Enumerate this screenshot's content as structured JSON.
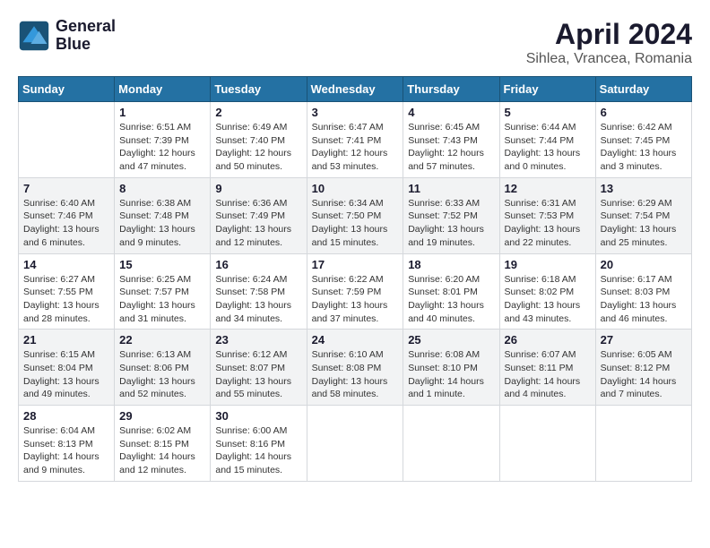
{
  "header": {
    "logo_line1": "General",
    "logo_line2": "Blue",
    "title": "April 2024",
    "subtitle": "Sihlea, Vrancea, Romania"
  },
  "calendar": {
    "days_of_week": [
      "Sunday",
      "Monday",
      "Tuesday",
      "Wednesday",
      "Thursday",
      "Friday",
      "Saturday"
    ],
    "weeks": [
      [
        {
          "day": "",
          "info": ""
        },
        {
          "day": "1",
          "info": "Sunrise: 6:51 AM\nSunset: 7:39 PM\nDaylight: 12 hours\nand 47 minutes."
        },
        {
          "day": "2",
          "info": "Sunrise: 6:49 AM\nSunset: 7:40 PM\nDaylight: 12 hours\nand 50 minutes."
        },
        {
          "day": "3",
          "info": "Sunrise: 6:47 AM\nSunset: 7:41 PM\nDaylight: 12 hours\nand 53 minutes."
        },
        {
          "day": "4",
          "info": "Sunrise: 6:45 AM\nSunset: 7:43 PM\nDaylight: 12 hours\nand 57 minutes."
        },
        {
          "day": "5",
          "info": "Sunrise: 6:44 AM\nSunset: 7:44 PM\nDaylight: 13 hours\nand 0 minutes."
        },
        {
          "day": "6",
          "info": "Sunrise: 6:42 AM\nSunset: 7:45 PM\nDaylight: 13 hours\nand 3 minutes."
        }
      ],
      [
        {
          "day": "7",
          "info": "Sunrise: 6:40 AM\nSunset: 7:46 PM\nDaylight: 13 hours\nand 6 minutes."
        },
        {
          "day": "8",
          "info": "Sunrise: 6:38 AM\nSunset: 7:48 PM\nDaylight: 13 hours\nand 9 minutes."
        },
        {
          "day": "9",
          "info": "Sunrise: 6:36 AM\nSunset: 7:49 PM\nDaylight: 13 hours\nand 12 minutes."
        },
        {
          "day": "10",
          "info": "Sunrise: 6:34 AM\nSunset: 7:50 PM\nDaylight: 13 hours\nand 15 minutes."
        },
        {
          "day": "11",
          "info": "Sunrise: 6:33 AM\nSunset: 7:52 PM\nDaylight: 13 hours\nand 19 minutes."
        },
        {
          "day": "12",
          "info": "Sunrise: 6:31 AM\nSunset: 7:53 PM\nDaylight: 13 hours\nand 22 minutes."
        },
        {
          "day": "13",
          "info": "Sunrise: 6:29 AM\nSunset: 7:54 PM\nDaylight: 13 hours\nand 25 minutes."
        }
      ],
      [
        {
          "day": "14",
          "info": "Sunrise: 6:27 AM\nSunset: 7:55 PM\nDaylight: 13 hours\nand 28 minutes."
        },
        {
          "day": "15",
          "info": "Sunrise: 6:25 AM\nSunset: 7:57 PM\nDaylight: 13 hours\nand 31 minutes."
        },
        {
          "day": "16",
          "info": "Sunrise: 6:24 AM\nSunset: 7:58 PM\nDaylight: 13 hours\nand 34 minutes."
        },
        {
          "day": "17",
          "info": "Sunrise: 6:22 AM\nSunset: 7:59 PM\nDaylight: 13 hours\nand 37 minutes."
        },
        {
          "day": "18",
          "info": "Sunrise: 6:20 AM\nSunset: 8:01 PM\nDaylight: 13 hours\nand 40 minutes."
        },
        {
          "day": "19",
          "info": "Sunrise: 6:18 AM\nSunset: 8:02 PM\nDaylight: 13 hours\nand 43 minutes."
        },
        {
          "day": "20",
          "info": "Sunrise: 6:17 AM\nSunset: 8:03 PM\nDaylight: 13 hours\nand 46 minutes."
        }
      ],
      [
        {
          "day": "21",
          "info": "Sunrise: 6:15 AM\nSunset: 8:04 PM\nDaylight: 13 hours\nand 49 minutes."
        },
        {
          "day": "22",
          "info": "Sunrise: 6:13 AM\nSunset: 8:06 PM\nDaylight: 13 hours\nand 52 minutes."
        },
        {
          "day": "23",
          "info": "Sunrise: 6:12 AM\nSunset: 8:07 PM\nDaylight: 13 hours\nand 55 minutes."
        },
        {
          "day": "24",
          "info": "Sunrise: 6:10 AM\nSunset: 8:08 PM\nDaylight: 13 hours\nand 58 minutes."
        },
        {
          "day": "25",
          "info": "Sunrise: 6:08 AM\nSunset: 8:10 PM\nDaylight: 14 hours\nand 1 minute."
        },
        {
          "day": "26",
          "info": "Sunrise: 6:07 AM\nSunset: 8:11 PM\nDaylight: 14 hours\nand 4 minutes."
        },
        {
          "day": "27",
          "info": "Sunrise: 6:05 AM\nSunset: 8:12 PM\nDaylight: 14 hours\nand 7 minutes."
        }
      ],
      [
        {
          "day": "28",
          "info": "Sunrise: 6:04 AM\nSunset: 8:13 PM\nDaylight: 14 hours\nand 9 minutes."
        },
        {
          "day": "29",
          "info": "Sunrise: 6:02 AM\nSunset: 8:15 PM\nDaylight: 14 hours\nand 12 minutes."
        },
        {
          "day": "30",
          "info": "Sunrise: 6:00 AM\nSunset: 8:16 PM\nDaylight: 14 hours\nand 15 minutes."
        },
        {
          "day": "",
          "info": ""
        },
        {
          "day": "",
          "info": ""
        },
        {
          "day": "",
          "info": ""
        },
        {
          "day": "",
          "info": ""
        }
      ]
    ]
  }
}
